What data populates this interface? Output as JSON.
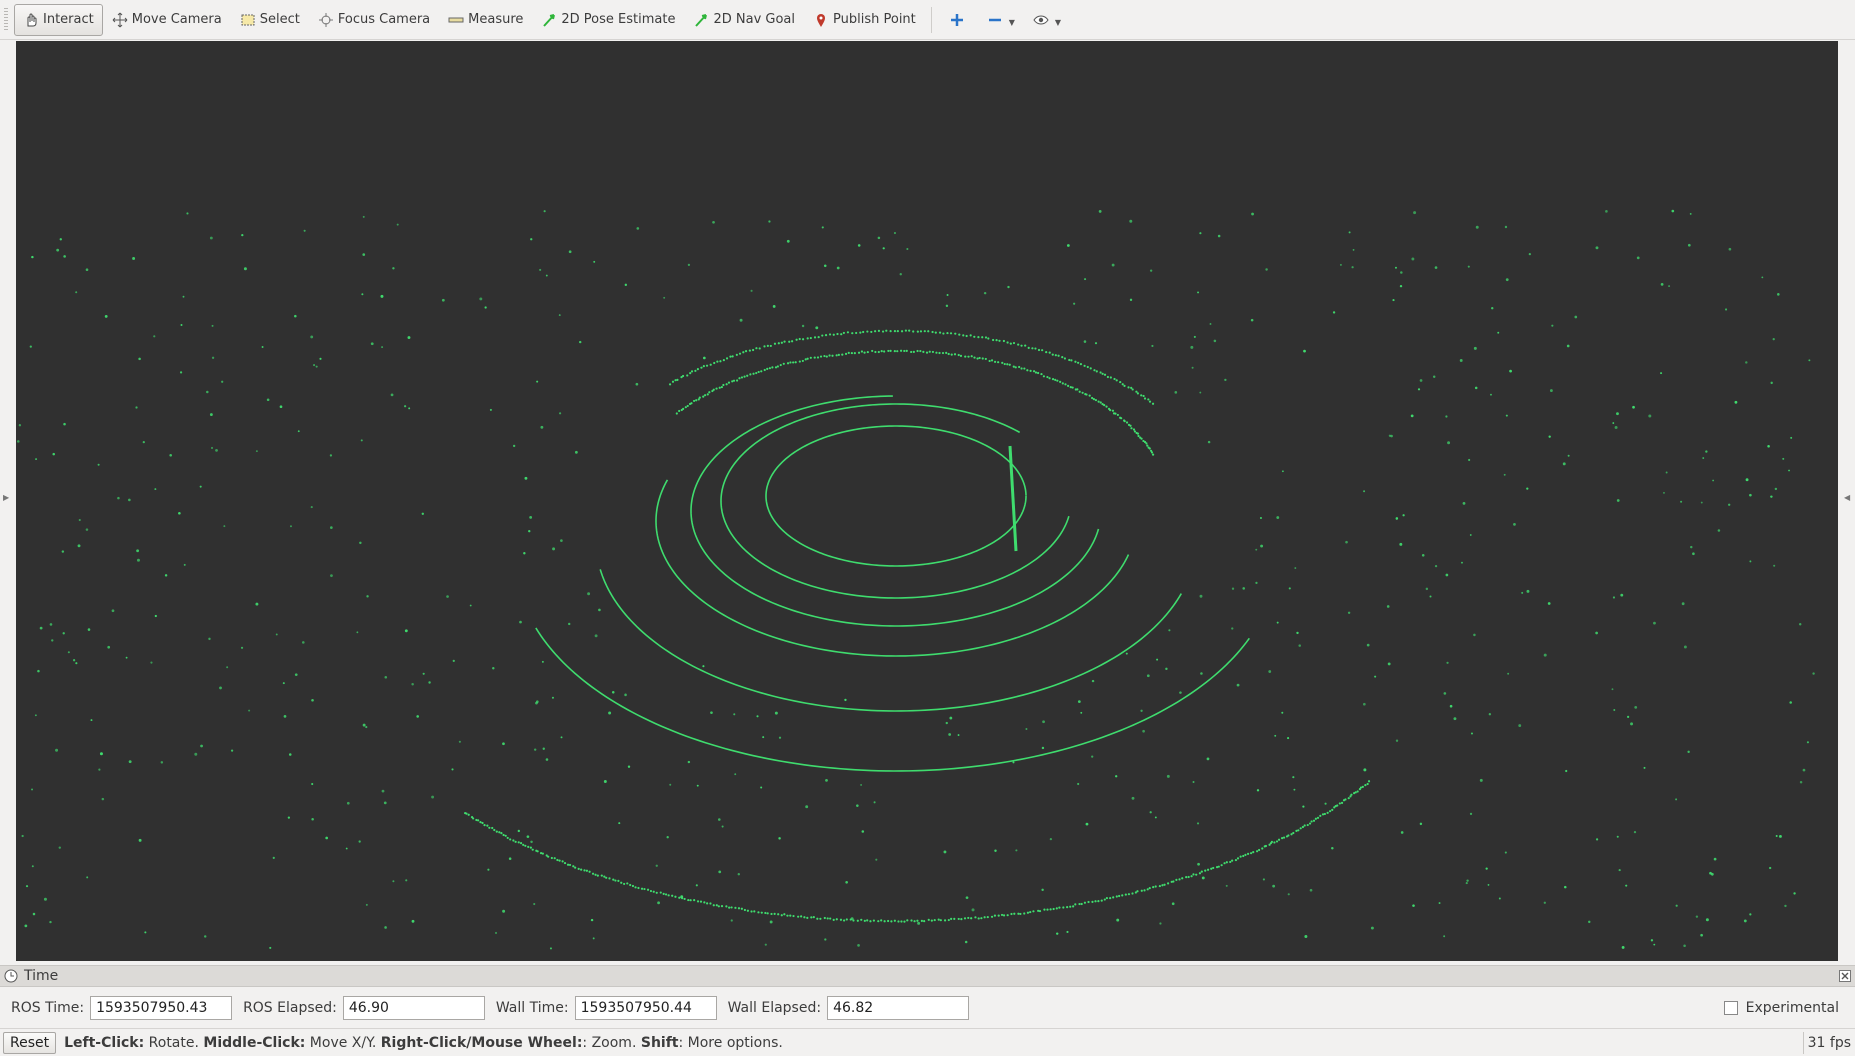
{
  "toolbar": {
    "tools": [
      {
        "label": "Interact",
        "icon": "hand-cursor-icon",
        "active": true
      },
      {
        "label": "Move Camera",
        "icon": "move-arrows-icon"
      },
      {
        "label": "Select",
        "icon": "select-box-icon"
      },
      {
        "label": "Focus Camera",
        "icon": "crosshair-icon"
      },
      {
        "label": "Measure",
        "icon": "ruler-icon"
      },
      {
        "label": "2D Pose Estimate",
        "icon": "green-arrow-icon"
      },
      {
        "label": "2D Nav Goal",
        "icon": "green-arrow-icon"
      },
      {
        "label": "Publish Point",
        "icon": "map-pin-icon"
      }
    ],
    "extra_icons": [
      "plus-icon",
      "minus-icon",
      "eye-icon"
    ],
    "accent_color": "#2a74c9"
  },
  "viewport": {
    "background": "#303030",
    "point_color": "#3fdc6e"
  },
  "time_panel": {
    "title": "Time",
    "ros_time_label": "ROS Time:",
    "ros_time_value": "1593507950.43",
    "ros_elapsed_label": "ROS Elapsed:",
    "ros_elapsed_value": "46.90",
    "wall_time_label": "Wall Time:",
    "wall_time_value": "1593507950.44",
    "wall_elapsed_label": "Wall Elapsed:",
    "wall_elapsed_value": "46.82",
    "experimental_label": "Experimental",
    "experimental_checked": false
  },
  "status_bar": {
    "reset_label": "Reset",
    "hint": [
      {
        "bold": "Left-Click:",
        "text": " Rotate. "
      },
      {
        "bold": "Middle-Click:",
        "text": " Move X/Y. "
      },
      {
        "bold": "Right-Click/Mouse Wheel:",
        "text": ": Zoom. "
      },
      {
        "bold": "Shift",
        "text": ": More options."
      }
    ],
    "fps": "31 fps"
  }
}
